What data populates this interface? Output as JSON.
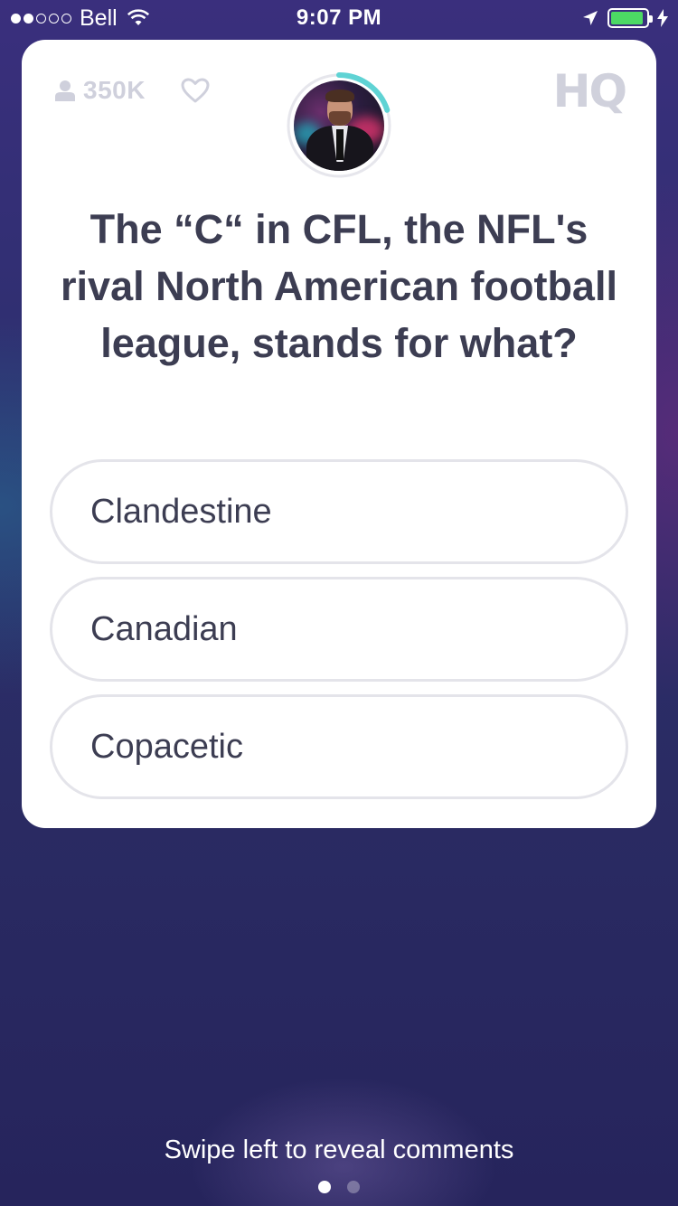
{
  "status_bar": {
    "carrier": "Bell",
    "time": "9:07 PM",
    "signal_bars_filled": 2,
    "signal_bars_total": 5,
    "battery_level": 0.92,
    "battery_color": "#4cd964"
  },
  "header": {
    "viewer_count": "350K",
    "viewer_icon": "person-icon",
    "heart_icon": "heart-icon",
    "logo": "HQ",
    "timer_progress": 0.2,
    "timer_color": "#5fd3d4"
  },
  "question": {
    "text": "The “C“ in CFL, the NFL's rival North American football league, stands for what?"
  },
  "answers": [
    {
      "label": "Clandestine"
    },
    {
      "label": "Canadian"
    },
    {
      "label": "Copacetic"
    }
  ],
  "footer": {
    "hint": "Swipe left to reveal comments",
    "page_count": 2,
    "active_page": 1
  }
}
